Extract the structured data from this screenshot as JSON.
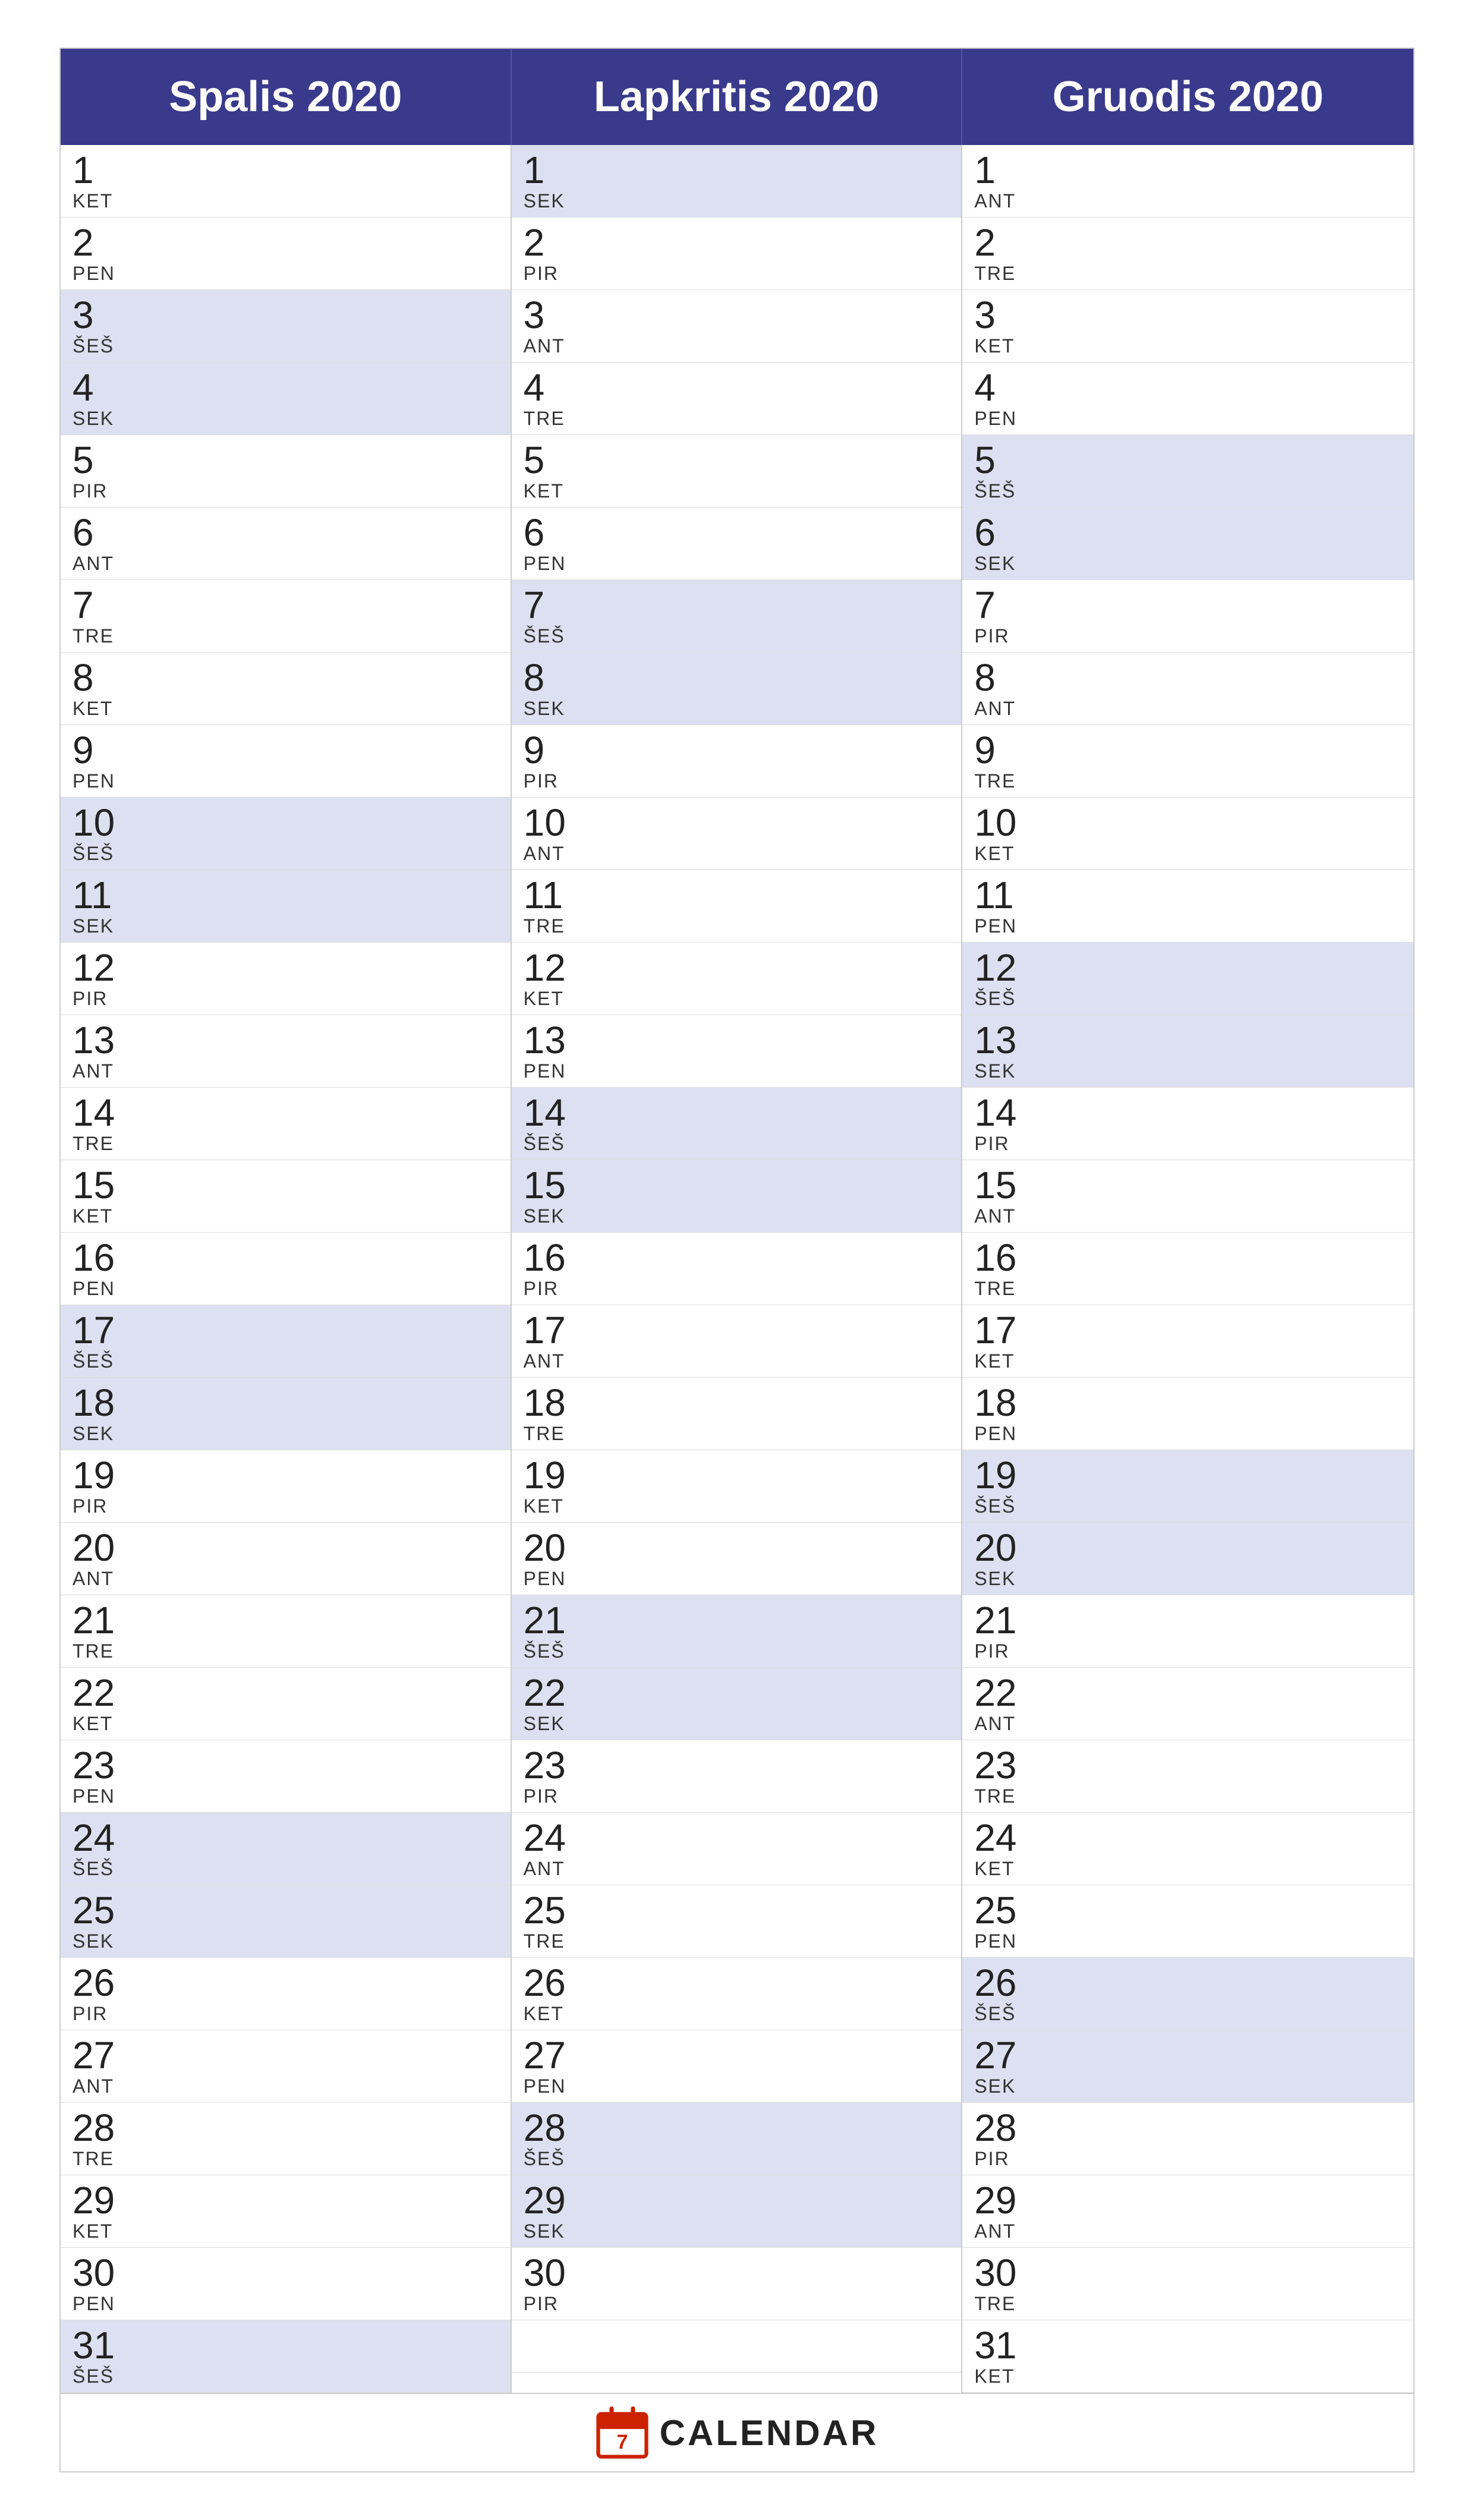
{
  "months": [
    {
      "name": "Spalis 2020",
      "days": [
        {
          "num": "1",
          "day": "KET",
          "weekend": false
        },
        {
          "num": "2",
          "day": "PEN",
          "weekend": false
        },
        {
          "num": "3",
          "day": "ŠEŠ",
          "weekend": true
        },
        {
          "num": "4",
          "day": "SEK",
          "weekend": true
        },
        {
          "num": "5",
          "day": "PIR",
          "weekend": false
        },
        {
          "num": "6",
          "day": "ANT",
          "weekend": false
        },
        {
          "num": "7",
          "day": "TRE",
          "weekend": false
        },
        {
          "num": "8",
          "day": "KET",
          "weekend": false
        },
        {
          "num": "9",
          "day": "PEN",
          "weekend": false
        },
        {
          "num": "10",
          "day": "ŠEŠ",
          "weekend": true
        },
        {
          "num": "11",
          "day": "SEK",
          "weekend": true
        },
        {
          "num": "12",
          "day": "PIR",
          "weekend": false
        },
        {
          "num": "13",
          "day": "ANT",
          "weekend": false
        },
        {
          "num": "14",
          "day": "TRE",
          "weekend": false
        },
        {
          "num": "15",
          "day": "KET",
          "weekend": false
        },
        {
          "num": "16",
          "day": "PEN",
          "weekend": false
        },
        {
          "num": "17",
          "day": "ŠEŠ",
          "weekend": true
        },
        {
          "num": "18",
          "day": "SEK",
          "weekend": true
        },
        {
          "num": "19",
          "day": "PIR",
          "weekend": false
        },
        {
          "num": "20",
          "day": "ANT",
          "weekend": false
        },
        {
          "num": "21",
          "day": "TRE",
          "weekend": false
        },
        {
          "num": "22",
          "day": "KET",
          "weekend": false
        },
        {
          "num": "23",
          "day": "PEN",
          "weekend": false
        },
        {
          "num": "24",
          "day": "ŠEŠ",
          "weekend": true
        },
        {
          "num": "25",
          "day": "SEK",
          "weekend": true
        },
        {
          "num": "26",
          "day": "PIR",
          "weekend": false
        },
        {
          "num": "27",
          "day": "ANT",
          "weekend": false
        },
        {
          "num": "28",
          "day": "TRE",
          "weekend": false
        },
        {
          "num": "29",
          "day": "KET",
          "weekend": false
        },
        {
          "num": "30",
          "day": "PEN",
          "weekend": false
        },
        {
          "num": "31",
          "day": "ŠEŠ",
          "weekend": true
        }
      ]
    },
    {
      "name": "Lapkritis 2020",
      "days": [
        {
          "num": "1",
          "day": "SEK",
          "weekend": true
        },
        {
          "num": "2",
          "day": "PIR",
          "weekend": false
        },
        {
          "num": "3",
          "day": "ANT",
          "weekend": false
        },
        {
          "num": "4",
          "day": "TRE",
          "weekend": false
        },
        {
          "num": "5",
          "day": "KET",
          "weekend": false
        },
        {
          "num": "6",
          "day": "PEN",
          "weekend": false
        },
        {
          "num": "7",
          "day": "ŠEŠ",
          "weekend": true
        },
        {
          "num": "8",
          "day": "SEK",
          "weekend": true
        },
        {
          "num": "9",
          "day": "PIR",
          "weekend": false
        },
        {
          "num": "10",
          "day": "ANT",
          "weekend": false
        },
        {
          "num": "11",
          "day": "TRE",
          "weekend": false
        },
        {
          "num": "12",
          "day": "KET",
          "weekend": false
        },
        {
          "num": "13",
          "day": "PEN",
          "weekend": false
        },
        {
          "num": "14",
          "day": "ŠEŠ",
          "weekend": true
        },
        {
          "num": "15",
          "day": "SEK",
          "weekend": true
        },
        {
          "num": "16",
          "day": "PIR",
          "weekend": false
        },
        {
          "num": "17",
          "day": "ANT",
          "weekend": false
        },
        {
          "num": "18",
          "day": "TRE",
          "weekend": false
        },
        {
          "num": "19",
          "day": "KET",
          "weekend": false
        },
        {
          "num": "20",
          "day": "PEN",
          "weekend": false
        },
        {
          "num": "21",
          "day": "ŠEŠ",
          "weekend": true
        },
        {
          "num": "22",
          "day": "SEK",
          "weekend": true
        },
        {
          "num": "23",
          "day": "PIR",
          "weekend": false
        },
        {
          "num": "24",
          "day": "ANT",
          "weekend": false
        },
        {
          "num": "25",
          "day": "TRE",
          "weekend": false
        },
        {
          "num": "26",
          "day": "KET",
          "weekend": false
        },
        {
          "num": "27",
          "day": "PEN",
          "weekend": false
        },
        {
          "num": "28",
          "day": "ŠEŠ",
          "weekend": true
        },
        {
          "num": "29",
          "day": "SEK",
          "weekend": true
        },
        {
          "num": "30",
          "day": "PIR",
          "weekend": false
        },
        {
          "num": "",
          "day": "",
          "weekend": false
        }
      ]
    },
    {
      "name": "Gruodis 2020",
      "days": [
        {
          "num": "1",
          "day": "ANT",
          "weekend": false
        },
        {
          "num": "2",
          "day": "TRE",
          "weekend": false
        },
        {
          "num": "3",
          "day": "KET",
          "weekend": false
        },
        {
          "num": "4",
          "day": "PEN",
          "weekend": false
        },
        {
          "num": "5",
          "day": "ŠEŠ",
          "weekend": true
        },
        {
          "num": "6",
          "day": "SEK",
          "weekend": true
        },
        {
          "num": "7",
          "day": "PIR",
          "weekend": false
        },
        {
          "num": "8",
          "day": "ANT",
          "weekend": false
        },
        {
          "num": "9",
          "day": "TRE",
          "weekend": false
        },
        {
          "num": "10",
          "day": "KET",
          "weekend": false
        },
        {
          "num": "11",
          "day": "PEN",
          "weekend": false
        },
        {
          "num": "12",
          "day": "ŠEŠ",
          "weekend": true
        },
        {
          "num": "13",
          "day": "SEK",
          "weekend": true
        },
        {
          "num": "14",
          "day": "PIR",
          "weekend": false
        },
        {
          "num": "15",
          "day": "ANT",
          "weekend": false
        },
        {
          "num": "16",
          "day": "TRE",
          "weekend": false
        },
        {
          "num": "17",
          "day": "KET",
          "weekend": false
        },
        {
          "num": "18",
          "day": "PEN",
          "weekend": false
        },
        {
          "num": "19",
          "day": "ŠEŠ",
          "weekend": true
        },
        {
          "num": "20",
          "day": "SEK",
          "weekend": true
        },
        {
          "num": "21",
          "day": "PIR",
          "weekend": false
        },
        {
          "num": "22",
          "day": "ANT",
          "weekend": false
        },
        {
          "num": "23",
          "day": "TRE",
          "weekend": false
        },
        {
          "num": "24",
          "day": "KET",
          "weekend": false
        },
        {
          "num": "25",
          "day": "PEN",
          "weekend": false
        },
        {
          "num": "26",
          "day": "ŠEŠ",
          "weekend": true
        },
        {
          "num": "27",
          "day": "SEK",
          "weekend": true
        },
        {
          "num": "28",
          "day": "PIR",
          "weekend": false
        },
        {
          "num": "29",
          "day": "ANT",
          "weekend": false
        },
        {
          "num": "30",
          "day": "TRE",
          "weekend": false
        },
        {
          "num": "31",
          "day": "KET",
          "weekend": false
        }
      ]
    }
  ],
  "footer": {
    "logo_text": "CALENDAR"
  }
}
